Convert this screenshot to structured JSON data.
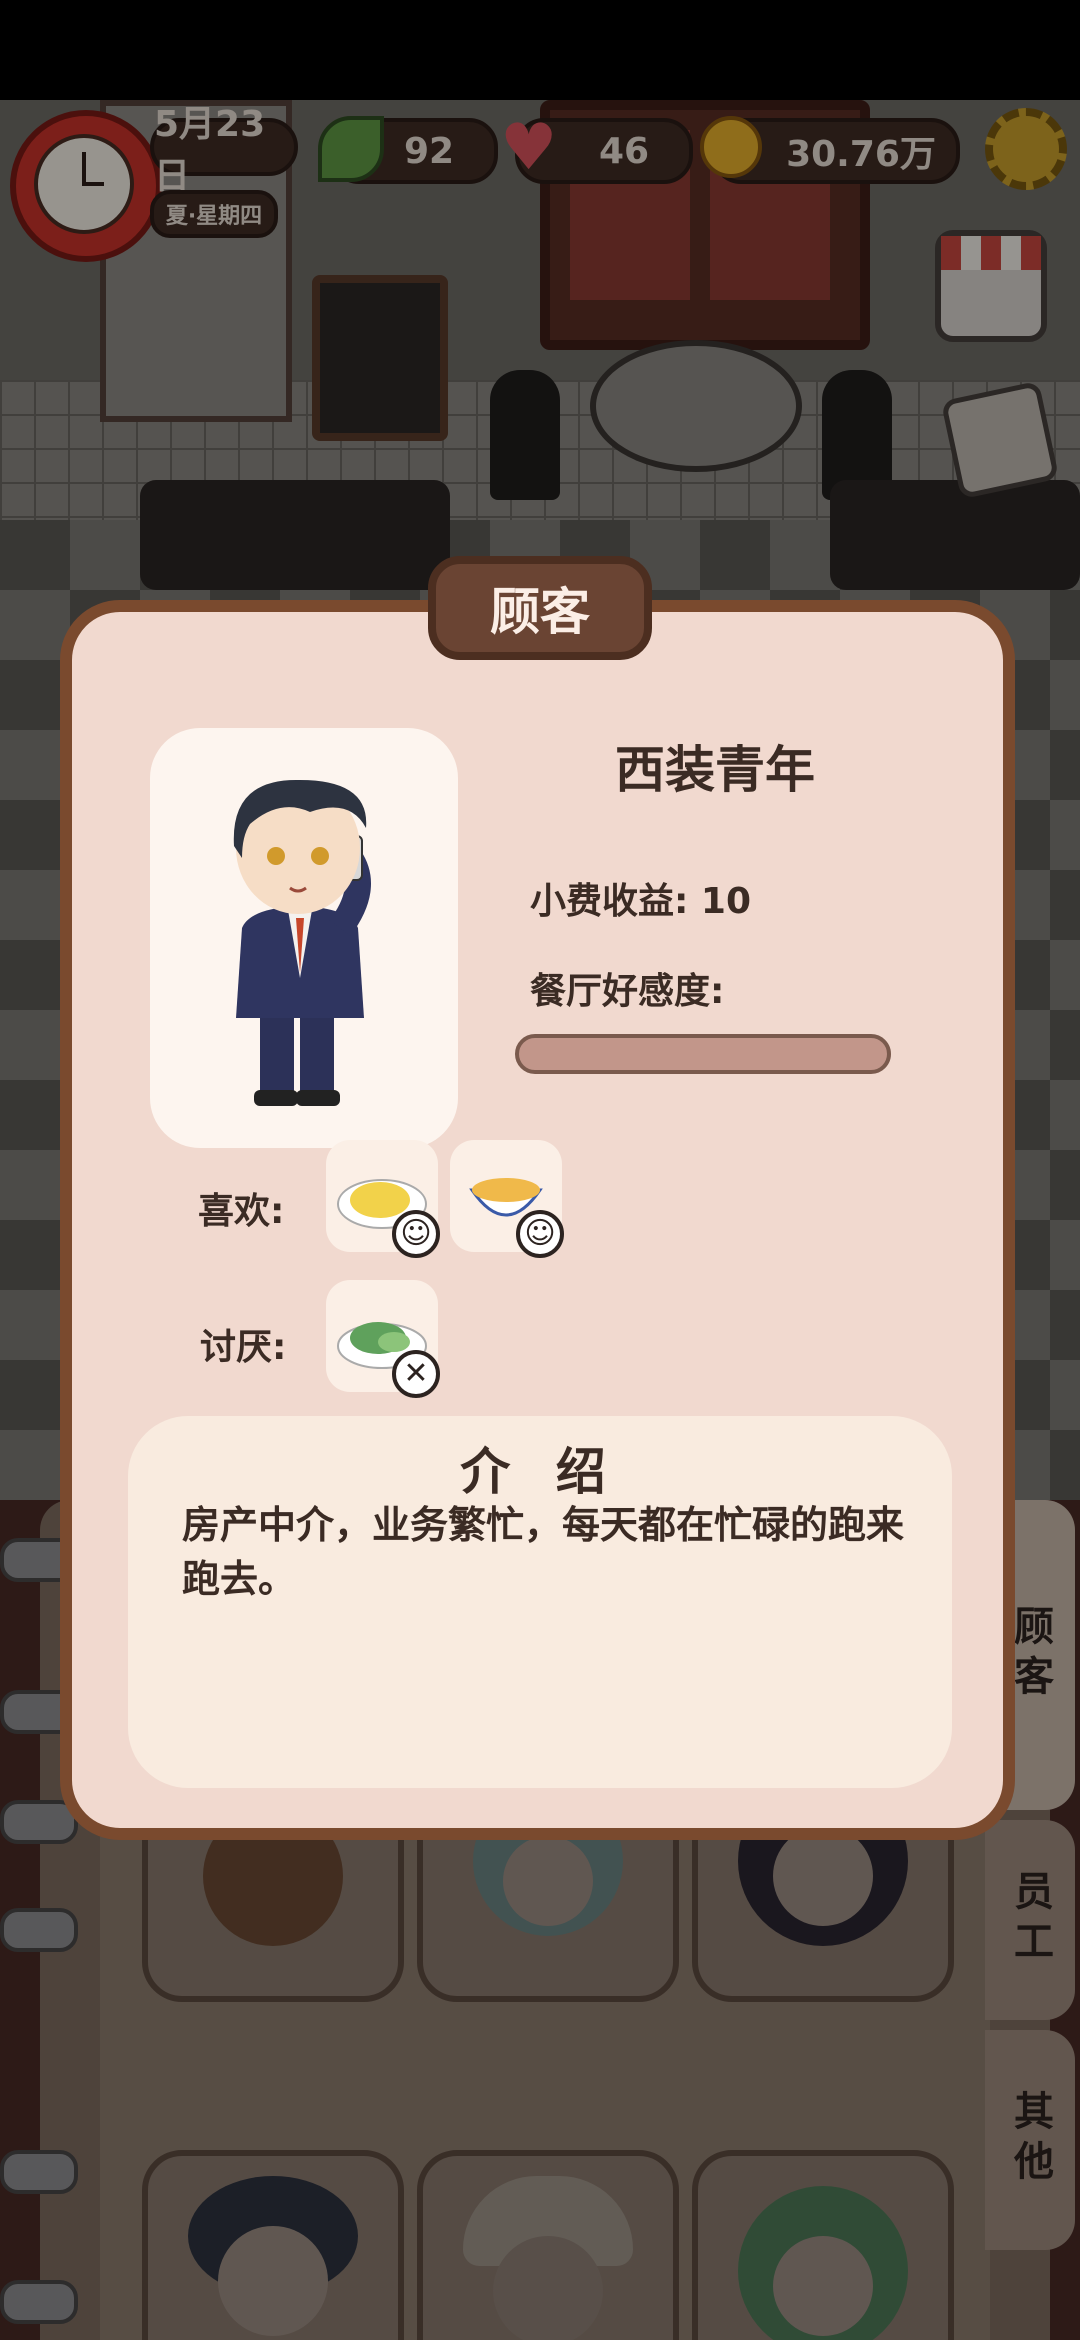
{
  "hud": {
    "date": "5月23日",
    "season_weekday": "夏·星期四",
    "leaf_count": "92",
    "heart_count": "46",
    "coins": "30.76万"
  },
  "dialog": {
    "title": "顾客",
    "customer_name": "西装青年",
    "tip_label": "小费收益: 10",
    "affinity_label": "餐厅好感度:",
    "affinity_value": 0,
    "likes_label": "喜欢:",
    "dislikes_label": "讨厌:",
    "likes": [
      "egg-omelette-dish-icon",
      "noodle-soup-bowl-icon"
    ],
    "dislikes": [
      "green-vegetable-dish-icon"
    ],
    "intro_title": "介 绍",
    "intro_text": "房产中介，业务繁忙，每天都在忙碌的跑来跑去。"
  },
  "side_tabs": [
    "顾客",
    "员工",
    "其他"
  ],
  "colors": {
    "dialog_bg": "#f1d9cf",
    "dialog_border": "#7a4a2e",
    "title_tab": "#6a4433",
    "text": "#3b2b24"
  }
}
